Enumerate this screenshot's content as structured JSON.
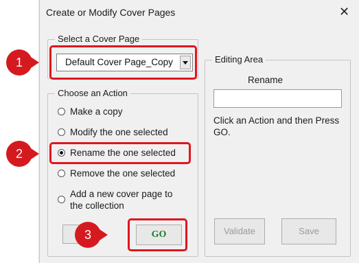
{
  "dialog": {
    "title": "Create or Modify Cover Pages",
    "close_icon": "close-icon"
  },
  "select_group": {
    "legend": "Select a Cover Page",
    "selected_value": "Default Cover Page_Copy"
  },
  "action_group": {
    "legend": "Choose an Action",
    "options": [
      {
        "label": "Make a copy",
        "selected": false
      },
      {
        "label": "Modify the one selected",
        "selected": false
      },
      {
        "label": "Rename the one selected",
        "selected": true
      },
      {
        "label": "Remove the one selected",
        "selected": false
      },
      {
        "label": "Add a new cover page to the collection",
        "line1": "Add a new cover page to",
        "line2": "the collection",
        "selected": false
      }
    ],
    "go_label": "GO"
  },
  "editing_area": {
    "legend": "Editing Area",
    "rename_label": "Rename",
    "rename_value": "",
    "instruction": "Click an Action and then Press GO.",
    "instruction_line1": "Click an Action and then Press",
    "instruction_line2": "GO.",
    "validate_label": "Validate",
    "save_label": "Save"
  },
  "annotations": {
    "step1": "1",
    "step2": "2",
    "step3": "3",
    "color": "#e0151e"
  }
}
